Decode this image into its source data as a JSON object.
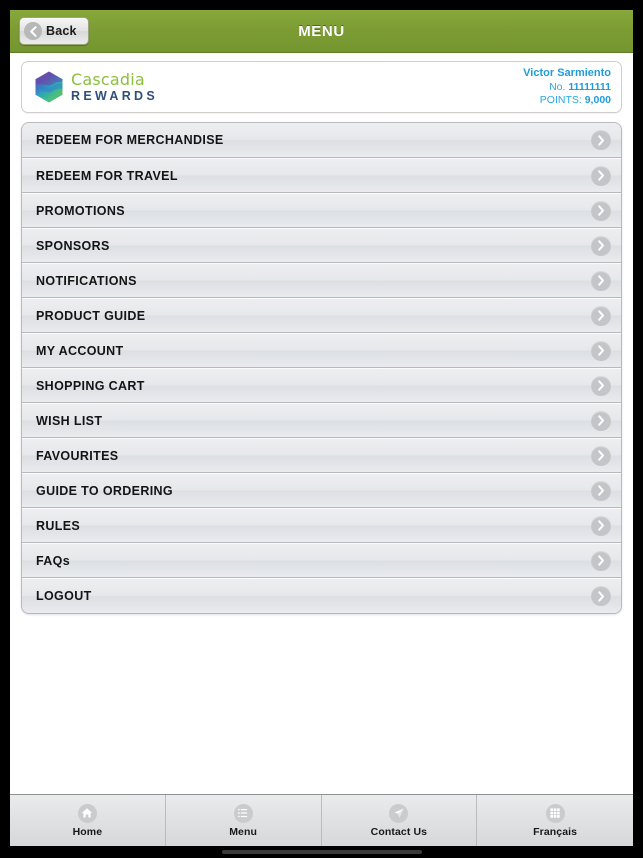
{
  "navbar": {
    "title": "MENU",
    "back_label": "Back",
    "back_icon": "chevron-left-icon",
    "background_color": "#7c9c33"
  },
  "account_card": {
    "brand": {
      "logo_icon": "cascadia-hexagon-logo",
      "name_top": "Cascadia",
      "name_bottom": "REWARDS",
      "color_top": "#8cbf3f",
      "color_bottom": "#2f4f7a"
    },
    "user_name": "Victor Sarmiento",
    "account_number_label": "No.",
    "account_number": "11111111",
    "points_label": "POINTS:",
    "points_value": "9,000",
    "text_color": "#29a8e0"
  },
  "menu": {
    "chevron_icon": "chevron-right-icon",
    "items": [
      {
        "label": "REDEEM FOR MERCHANDISE"
      },
      {
        "label": "REDEEM FOR TRAVEL"
      },
      {
        "label": "PROMOTIONS"
      },
      {
        "label": "SPONSORS"
      },
      {
        "label": "NOTIFICATIONS"
      },
      {
        "label": "PRODUCT GUIDE"
      },
      {
        "label": "MY ACCOUNT"
      },
      {
        "label": "SHOPPING CART"
      },
      {
        "label": "WISH LIST"
      },
      {
        "label": "FAVOURITES"
      },
      {
        "label": "GUIDE TO ORDERING"
      },
      {
        "label": "RULES"
      },
      {
        "label": "FAQs"
      },
      {
        "label": "LOGOUT"
      }
    ]
  },
  "tabbar": {
    "tabs": [
      {
        "label": "Home",
        "icon": "home-icon"
      },
      {
        "label": "Menu",
        "icon": "list-icon"
      },
      {
        "label": "Contact Us",
        "icon": "paper-plane-icon"
      },
      {
        "label": "Français",
        "icon": "grid-icon"
      }
    ]
  }
}
